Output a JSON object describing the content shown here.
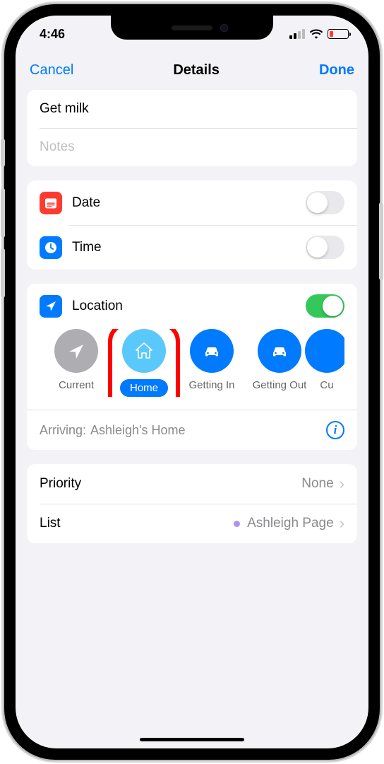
{
  "statusbar": {
    "time": "4:46"
  },
  "nav": {
    "cancel": "Cancel",
    "title": "Details",
    "done": "Done"
  },
  "reminder": {
    "title": "Get milk",
    "notes_placeholder": "Notes"
  },
  "date": {
    "label": "Date",
    "on": false
  },
  "time": {
    "label": "Time",
    "on": false
  },
  "location": {
    "label": "Location",
    "on": true,
    "options": [
      {
        "id": "current",
        "label": "Current"
      },
      {
        "id": "home",
        "label": "Home",
        "selected": true
      },
      {
        "id": "getin",
        "label": "Getting In"
      },
      {
        "id": "getout",
        "label": "Getting Out"
      },
      {
        "id": "custom",
        "label": "Cu"
      }
    ],
    "arriving_prefix": "Arriving:",
    "arriving_value": "Ashleigh's Home"
  },
  "priority": {
    "label": "Priority",
    "value": "None"
  },
  "list": {
    "label": "List",
    "value": "Ashleigh Page"
  }
}
